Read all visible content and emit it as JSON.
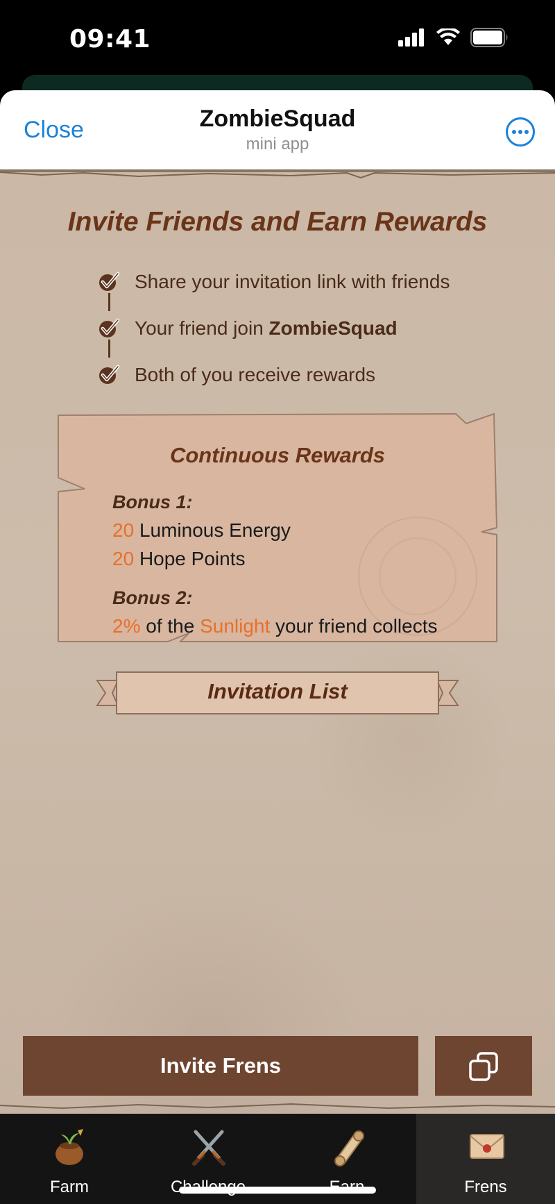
{
  "status_bar": {
    "time": "09:41",
    "icons": [
      "signal-icon",
      "wifi-icon",
      "battery-icon"
    ]
  },
  "header": {
    "close_label": "Close",
    "title": "ZombieSquad",
    "subtitle": "mini app",
    "more_icon": "more-icon"
  },
  "main": {
    "heading": "Invite Friends and Earn Rewards",
    "steps": [
      {
        "text": "Share your invitation link with friends"
      },
      {
        "text_prefix": "Your friend join ",
        "text_bold": "ZombieSquad"
      },
      {
        "text": "Both of you receive rewards"
      }
    ],
    "rewards": {
      "title": "Continuous Rewards",
      "bonus1_label": "Bonus 1:",
      "bonus1_items": [
        {
          "amount": "20",
          "name": "Luminous Energy"
        },
        {
          "amount": "20",
          "name": "Hope Points"
        }
      ],
      "bonus2_label": "Bonus 2:",
      "bonus2": {
        "percent": "2%",
        "text_a": " of the ",
        "highlight": "Sunlight",
        "text_b": " your friend collects"
      }
    },
    "invitation_list_title": "Invitation List"
  },
  "actions": {
    "invite_label": "Invite Frens",
    "copy_icon": "copy-icon"
  },
  "bottom_nav": {
    "items": [
      {
        "label": "Farm",
        "icon": "seed-pot-icon"
      },
      {
        "label": "Challenge",
        "icon": "crossed-swords-icon"
      },
      {
        "label": "Earn",
        "icon": "scroll-icon"
      },
      {
        "label": "Frens",
        "icon": "envelope-icon",
        "active": true
      }
    ]
  },
  "colors": {
    "accent_orange": "#e8702a",
    "brown_button": "#6e4530",
    "heading_brown": "#6a3418",
    "ios_blue": "#1a82d8"
  }
}
